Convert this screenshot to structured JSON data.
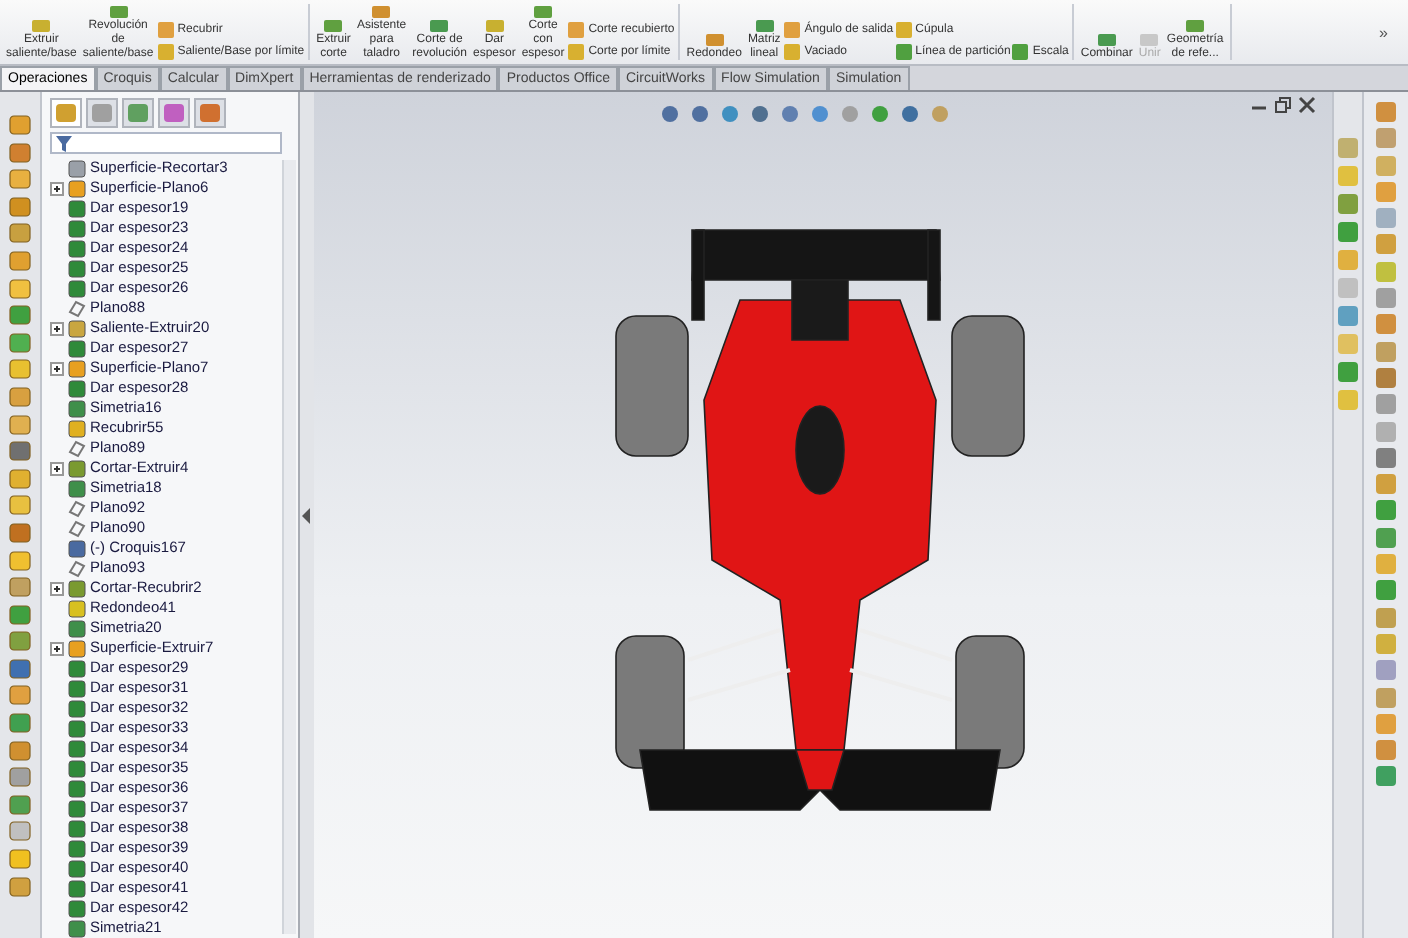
{
  "ribbon": {
    "groups": [
      {
        "items": [
          {
            "kind": "large",
            "label": "Extruir\nsaliente/base",
            "disabled": false
          },
          {
            "kind": "large",
            "label": "Revolución\nde\nsaliente/base",
            "disabled": false
          },
          {
            "kind": "stack",
            "entries": [
              "Recubrir",
              "Saliente/Base por límite"
            ]
          }
        ]
      },
      {
        "items": [
          {
            "kind": "large",
            "label": "Extruir\ncorte",
            "disabled": false
          },
          {
            "kind": "large",
            "label": "Asistente\npara\ntaladro",
            "disabled": false
          },
          {
            "kind": "large",
            "label": "Corte de\nrevolución",
            "disabled": false
          },
          {
            "kind": "large",
            "label": "Dar\nespesor",
            "disabled": false
          },
          {
            "kind": "large",
            "label": "Corte\ncon\nespesor",
            "disabled": false
          },
          {
            "kind": "stack",
            "entries": [
              "Corte recubierto",
              "Corte por límite"
            ]
          }
        ]
      },
      {
        "items": [
          {
            "kind": "large",
            "label": "Redondeo",
            "disabled": false
          },
          {
            "kind": "large",
            "label": "Matriz\nlineal",
            "disabled": false
          },
          {
            "kind": "stack",
            "entries": [
              "Ángulo de salida",
              "Vaciado"
            ]
          },
          {
            "kind": "stack",
            "entries": [
              "Cúpula",
              "Línea de partición"
            ]
          },
          {
            "kind": "stack",
            "entries": [
              "Escala"
            ]
          }
        ]
      },
      {
        "items": [
          {
            "kind": "large",
            "label": "Combinar",
            "disabled": false
          },
          {
            "kind": "large",
            "label": "Unir",
            "disabled": true
          },
          {
            "kind": "large",
            "label": "Geometría\nde refe...",
            "disabled": false
          }
        ]
      }
    ],
    "more": "»"
  },
  "tabs": [
    {
      "label": "Operaciones",
      "selected": true
    },
    {
      "label": "Croquis",
      "selected": false
    },
    {
      "label": "Calcular",
      "selected": false
    },
    {
      "label": "DimXpert",
      "selected": false
    },
    {
      "label": "Herramientas de renderizado",
      "selected": false
    },
    {
      "label": "Productos Office",
      "selected": false
    },
    {
      "label": "CircuitWorks",
      "selected": false
    },
    {
      "label": "Flow Simulation",
      "selected": false
    },
    {
      "label": "Simulation",
      "selected": false
    }
  ],
  "tree": {
    "items": [
      {
        "label": "Superficie-Recortar3",
        "kind": "trim",
        "expandable": false
      },
      {
        "label": "Superficie-Plano6",
        "kind": "surface",
        "expandable": true
      },
      {
        "label": "Dar espesor19",
        "kind": "thicken",
        "expandable": false
      },
      {
        "label": "Dar espesor23",
        "kind": "thicken",
        "expandable": false
      },
      {
        "label": "Dar espesor24",
        "kind": "thicken",
        "expandable": false
      },
      {
        "label": "Dar espesor25",
        "kind": "thicken",
        "expandable": false
      },
      {
        "label": "Dar espesor26",
        "kind": "thicken",
        "expandable": false
      },
      {
        "label": "Plano88",
        "kind": "plane",
        "expandable": false
      },
      {
        "label": "Saliente-Extruir20",
        "kind": "boss",
        "expandable": true
      },
      {
        "label": "Dar espesor27",
        "kind": "thicken",
        "expandable": false
      },
      {
        "label": "Superficie-Plano7",
        "kind": "surface",
        "expandable": true
      },
      {
        "label": "Dar espesor28",
        "kind": "thicken",
        "expandable": false
      },
      {
        "label": "Simetria16",
        "kind": "mirror",
        "expandable": false
      },
      {
        "label": "Recubrir55",
        "kind": "loft",
        "expandable": false
      },
      {
        "label": "Plano89",
        "kind": "plane",
        "expandable": false
      },
      {
        "label": "Cortar-Extruir4",
        "kind": "cut",
        "expandable": true
      },
      {
        "label": "Simetria18",
        "kind": "mirror",
        "expandable": false
      },
      {
        "label": "Plano92",
        "kind": "plane",
        "expandable": false
      },
      {
        "label": "Plano90",
        "kind": "plane",
        "expandable": false
      },
      {
        "label": "(-) Croquis167",
        "kind": "sketch",
        "expandable": false
      },
      {
        "label": "Plano93",
        "kind": "plane",
        "expandable": false
      },
      {
        "label": "Cortar-Recubrir2",
        "kind": "cut",
        "expandable": true
      },
      {
        "label": "Redondeo41",
        "kind": "fillet",
        "expandable": false
      },
      {
        "label": "Simetria20",
        "kind": "mirror",
        "expandable": false
      },
      {
        "label": "Superficie-Extruir7",
        "kind": "surface",
        "expandable": true
      },
      {
        "label": "Dar espesor29",
        "kind": "thicken",
        "expandable": false
      },
      {
        "label": "Dar espesor31",
        "kind": "thicken",
        "expandable": false
      },
      {
        "label": "Dar espesor32",
        "kind": "thicken",
        "expandable": false
      },
      {
        "label": "Dar espesor33",
        "kind": "thicken",
        "expandable": false
      },
      {
        "label": "Dar espesor34",
        "kind": "thicken",
        "expandable": false
      },
      {
        "label": "Dar espesor35",
        "kind": "thicken",
        "expandable": false
      },
      {
        "label": "Dar espesor36",
        "kind": "thicken",
        "expandable": false
      },
      {
        "label": "Dar espesor37",
        "kind": "thicken",
        "expandable": false
      },
      {
        "label": "Dar espesor38",
        "kind": "thicken",
        "expandable": false
      },
      {
        "label": "Dar espesor39",
        "kind": "thicken",
        "expandable": false
      },
      {
        "label": "Dar espesor40",
        "kind": "thicken",
        "expandable": false
      },
      {
        "label": "Dar espesor41",
        "kind": "thicken",
        "expandable": false
      },
      {
        "label": "Dar espesor42",
        "kind": "thicken",
        "expandable": false
      },
      {
        "label": "Simetria21",
        "kind": "mirror",
        "expandable": false
      }
    ]
  }
}
